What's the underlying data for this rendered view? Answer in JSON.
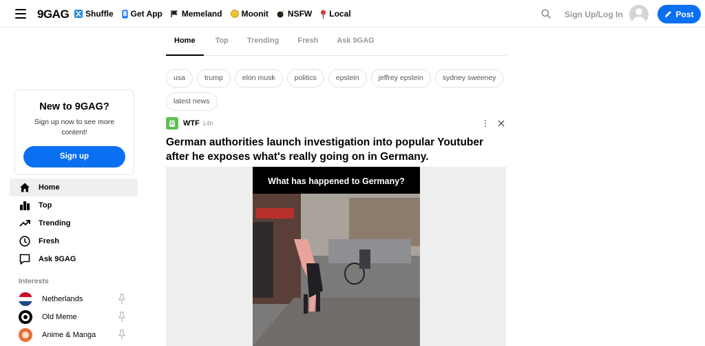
{
  "header": {
    "logo": "9GAG",
    "nav": [
      {
        "label": "Shuffle",
        "icon": "shuffle-icon",
        "color": "#2a8be0"
      },
      {
        "label": "Get App",
        "icon": "phone-icon",
        "color": "#0b6ff2"
      },
      {
        "label": "Memeland",
        "icon": "flag-icon",
        "color": "#222222"
      },
      {
        "label": "Moonit",
        "icon": "moon-coin-icon",
        "color": "#f1c232"
      },
      {
        "label": "NSFW",
        "icon": "bomb-icon",
        "color": "#222222"
      },
      {
        "label": "Local",
        "icon": "map-pin-icon",
        "color": "#d93a3a"
      }
    ],
    "signup_login": "Sign Up/Log In",
    "post_label": "Post"
  },
  "tabs": [
    "Home",
    "Top",
    "Trending",
    "Fresh",
    "Ask 9GAG"
  ],
  "active_tab": "Home",
  "tags": [
    "usa",
    "trump",
    "elon musk",
    "politics",
    "epstein",
    "jeffrey epstein",
    "sydney sweeney",
    "latest news"
  ],
  "post": {
    "section": "WTF",
    "age": "14h",
    "title": "German authorities launch investigation into popular Youtuber after he exposes what's really going on in Germany.",
    "video_caption": "What has happened to Germany?"
  },
  "signup_box": {
    "title": "New to 9GAG?",
    "text": "Sign up now to see more content!",
    "button": "Sign up"
  },
  "sidebar": {
    "items": [
      {
        "label": "Home",
        "icon": "home-icon",
        "active": true
      },
      {
        "label": "Top",
        "icon": "bar-chart-icon",
        "active": false
      },
      {
        "label": "Trending",
        "icon": "trending-icon",
        "active": false
      },
      {
        "label": "Fresh",
        "icon": "clock-icon",
        "active": false
      },
      {
        "label": "Ask 9GAG",
        "icon": "chat-bubble-icon",
        "active": false
      }
    ],
    "interests_label": "Interests",
    "interests": [
      {
        "label": "Netherlands",
        "icon": "netherlands-flag-icon"
      },
      {
        "label": "Old Meme",
        "icon": "old-meme-icon"
      },
      {
        "label": "Anime & Manga",
        "icon": "anime-icon"
      }
    ]
  },
  "colors": {
    "accent": "#0b6ff2",
    "wtf": "#5fbf52"
  }
}
